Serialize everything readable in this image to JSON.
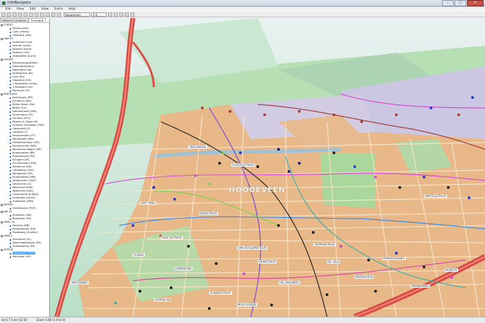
{
  "window": {
    "title": "InfoNavigator"
  },
  "menu": [
    "File",
    "View",
    "Edit",
    "View",
    "Extra",
    "Help"
  ],
  "toolbar": {
    "layer_select": "Hoogeveen",
    "zoom_select": "1:0"
  },
  "sidebar": {
    "tabs": [
      "Network Locations",
      "Timetable"
    ],
    "groups": [
      {
        "label": "COEVO",
        "items": [
          "Waalschoten",
          "Coev (Hfnee)",
          "Oldenbus (DN)"
        ]
      },
      {
        "label": "HWECO",
        "items": [
          "Sortenwel (net)",
          "Sizenet (vrnw)",
          "Kovelnd (ksnb)",
          "Rotterm (HH)",
          "Zoppstekel (k.snt)"
        ]
      },
      {
        "label": "OSSERT",
        "items": [
          "Nieuwhouwa(KMen)",
          "Dolendam(Hlarc)",
          "Dolendam (vg)",
          "Kalkwerken (Ka)",
          "Gust (Bs)",
          "Hoogeind (KH)",
          "'t Noordelijk (nHoo)",
          "'t Hefswerk (Hs)",
          "Marerwal (Hl)"
        ]
      },
      {
        "label": "PEKTEWEV",
        "items": [
          "Kerkwegen (BR)",
          "Schobrus (Dal)",
          "Bijhen Bosch (Bs)",
          "Bijhen (Lik)",
          "Damsterwerk (NM)",
          "Sunersdorp (FZ)",
          "Fondaal (STG)",
          "Rekens & Ogere (N)",
          "Fluwerin Schouwer (PDF)",
          "Hoogveldt (S)",
          "Labelten (T)",
          "Kerpenerdam (FF)",
          "Marsenbelt (MM)",
          "Heiwestoerhaar (VPJ)",
          "Rasnend Hen (MM)",
          "Wensende Wagen (BK)",
          "Ruwermeest (BB)",
          "Prangenveld (PD)",
          "Schagen (DF)",
          "Schijndelveld (SW)",
          "Skedanne (DN)",
          "Uttrosberg (Uttr)",
          "Mangerzee (ER)",
          "Ruwermeest (MM)",
          "Veldanzaam (VAZ)",
          "Leyssiveld (LV)",
          "Waveveld (KLW)",
          "Waterveld (RAS)",
          "Unitsvantrand (BAZ)",
          "Zuidbroek (HSSH)",
          "Zuidbroek (ZBR)"
        ]
      },
      {
        "label": "MEPPEL",
        "items": [
          "Vierdenplan (PDF)"
        ]
      },
      {
        "label": "NW 29",
        "items": [
          "Sluiswerk (SW)",
          "Rollerlaan (KK)"
        ]
      },
      {
        "label": "HMSL 29",
        "items": [
          "Nicolaas (BB)",
          "Rondsewelde (Rb)",
          "Plaatsweg (Grotten)"
        ]
      },
      {
        "label": "HMSLE",
        "items": [
          "Zandwind (Sn)",
          "Wienengekoelijke (Hk)",
          "Zuiltekaamp (ZN)"
        ]
      },
      {
        "label": "SRFEVE",
        "items": [
          "Hoogeveen (HGV)",
          "Mainzijde (HZ)"
        ]
      }
    ],
    "selected": "Hoogeveen (HGV)"
  },
  "map": {
    "place_name": "HOOGEVEEN",
    "labels": [
      "VERLENGDE",
      "SCHOOLSTRAAT",
      "GRIFTWEG",
      "KERKSTRAAT",
      "HOOFDSTRAAT",
      "SLINGE",
      "ROMANTIEK",
      "VAN ROSSUMSTRAAT",
      "RIEMSTRAAT",
      "VELLINGAWEG",
      "TERPENSTRAAT",
      "DE VELD",
      "PRINSESSEWEG",
      "MEREHOEVE",
      "ZWANENWEG",
      "WESTEINDE",
      "ZUIDERSTRAAT",
      "VOORSLAN",
      "MOOI OORDE",
      "AMSTELSTRAAT",
      "MORSTE"
    ],
    "colors": {
      "urban": "#e8b889",
      "field": "#a9d79c",
      "water": "#9ec1d6",
      "highway": "#d94b47",
      "industrial": "#c8c2e0"
    }
  },
  "statusbar": {
    "coords": "lat 6 7 5 lon 52 50",
    "zoom": "Zoom 5.80 (1:0 to 8)"
  }
}
